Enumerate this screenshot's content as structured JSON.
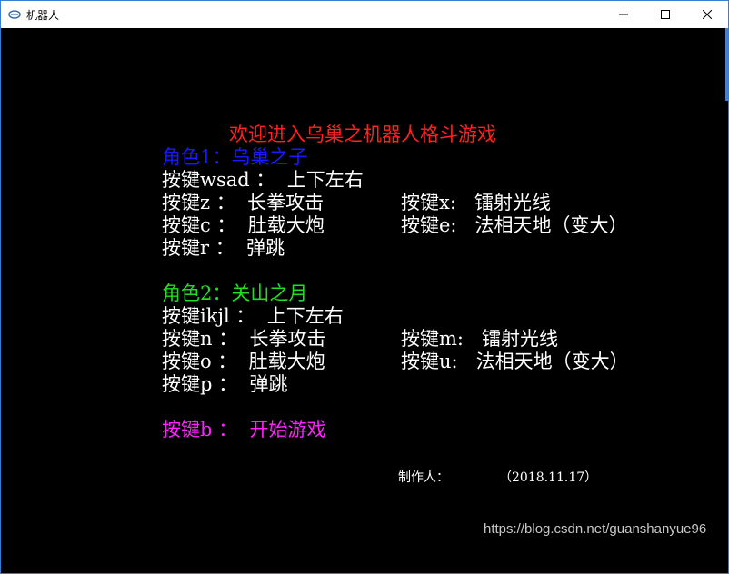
{
  "window": {
    "title": "机器人",
    "minimize_glyph": "–",
    "maximize_glyph": "☐",
    "close_glyph": "✕"
  },
  "console": {
    "welcome": "欢迎进入乌巢之机器人格斗游戏",
    "role1": {
      "header": "角色1：乌巢之子",
      "move": "按键wsad ：  上下左右",
      "z_key": "按键z ：  长拳攻击",
      "x_key": "按键x:   镭射光线",
      "c_key": "按键c ：  肚载大炮",
      "e_key": "按键e:   法相天地（变大）",
      "r_key": "按键r ：  弹跳"
    },
    "role2": {
      "header": "角色2：关山之月",
      "move": "按键ikjl ：  上下左右",
      "n_key": "按键n ：  长拳攻击",
      "m_key": "按键m:   镭射光线",
      "o_key": "按键o ：  肚载大炮",
      "u_key": "按键u:   法相天地（变大）",
      "p_key": "按键p ：  弹跳"
    },
    "start": "按键b ：  开始游戏",
    "author_label": "制作人：",
    "author_date": "（2018.11.17）"
  },
  "watermark": "https://blog.csdn.net/guanshanyue96",
  "colors": {
    "background": "#000000",
    "welcome": "#ff2020",
    "role1": "#1a1aff",
    "role2": "#22dd22",
    "start": "#ff22ff",
    "text": "#ffffff"
  }
}
